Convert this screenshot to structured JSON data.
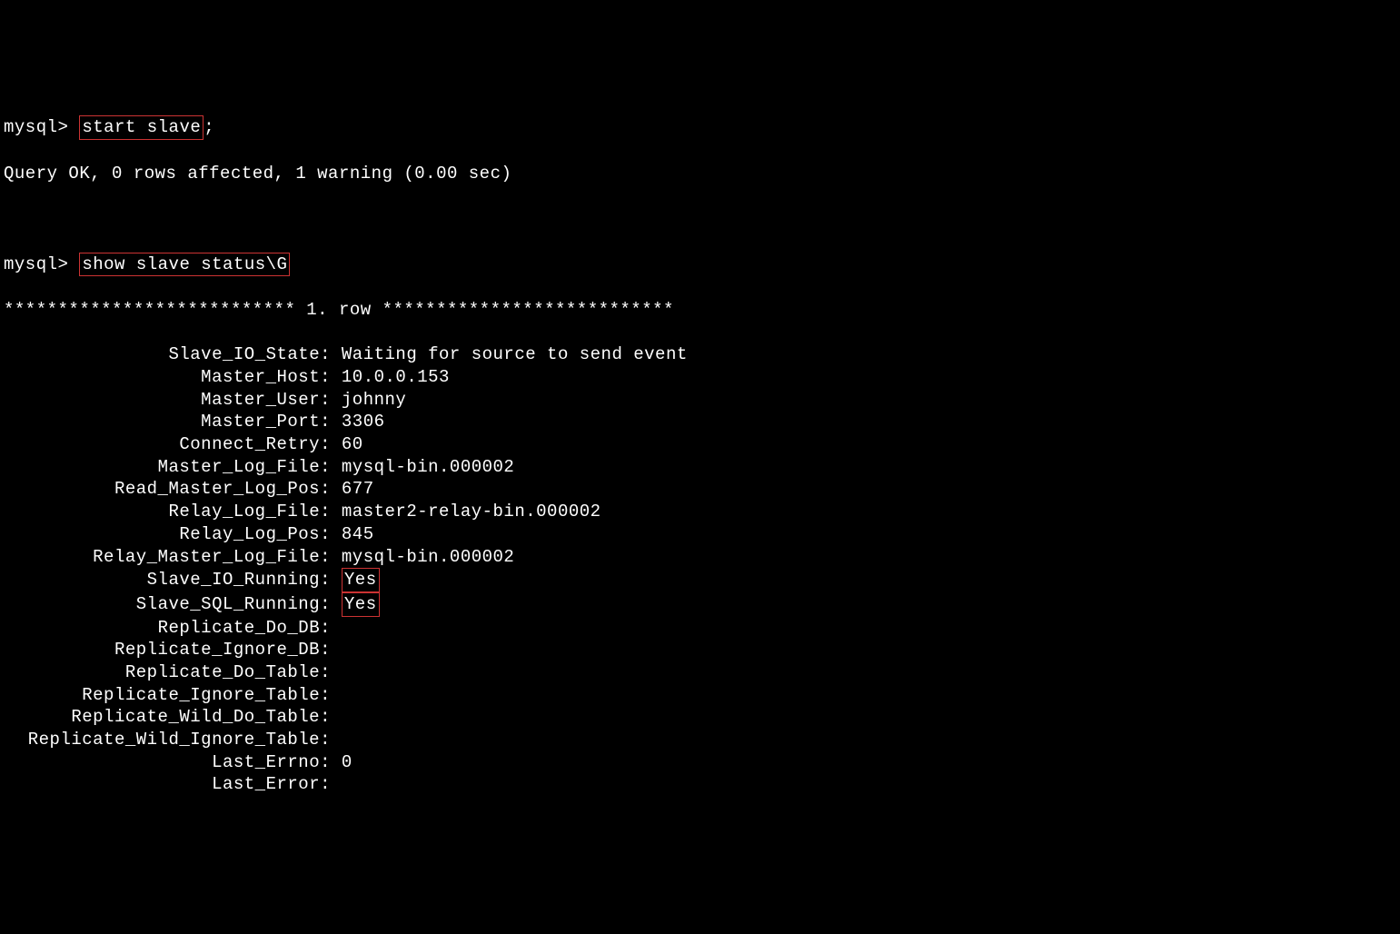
{
  "prompt1": "mysql> ",
  "command1": "start slave",
  "command1_suffix": ";",
  "response1": "Query OK, 0 rows affected, 1 warning (0.00 sec)",
  "prompt2": "mysql> ",
  "command2": "show slave status\\G",
  "row_separator": "*************************** 1. row ***************************",
  "status": {
    "fields": [
      {
        "label": "Slave_IO_State",
        "value": "Waiting for source to send event",
        "highlight": false
      },
      {
        "label": "Master_Host",
        "value": "10.0.0.153",
        "highlight": false
      },
      {
        "label": "Master_User",
        "value": "johnny",
        "highlight": false
      },
      {
        "label": "Master_Port",
        "value": "3306",
        "highlight": false
      },
      {
        "label": "Connect_Retry",
        "value": "60",
        "highlight": false
      },
      {
        "label": "Master_Log_File",
        "value": "mysql-bin.000002",
        "highlight": false
      },
      {
        "label": "Read_Master_Log_Pos",
        "value": "677",
        "highlight": false
      },
      {
        "label": "Relay_Log_File",
        "value": "master2-relay-bin.000002",
        "highlight": false
      },
      {
        "label": "Relay_Log_Pos",
        "value": "845",
        "highlight": false
      },
      {
        "label": "Relay_Master_Log_File",
        "value": "mysql-bin.000002",
        "highlight": false
      },
      {
        "label": "Slave_IO_Running",
        "value": "Yes",
        "highlight": true
      },
      {
        "label": "Slave_SQL_Running",
        "value": "Yes",
        "highlight": true
      },
      {
        "label": "Replicate_Do_DB",
        "value": "",
        "highlight": false
      },
      {
        "label": "Replicate_Ignore_DB",
        "value": "",
        "highlight": false
      },
      {
        "label": "Replicate_Do_Table",
        "value": "",
        "highlight": false
      },
      {
        "label": "Replicate_Ignore_Table",
        "value": "",
        "highlight": false
      },
      {
        "label": "Replicate_Wild_Do_Table",
        "value": "",
        "highlight": false
      },
      {
        "label": "Replicate_Wild_Ignore_Table",
        "value": "",
        "highlight": false
      },
      {
        "label": "Last_Errno",
        "value": "0",
        "highlight": false
      },
      {
        "label": "Last_Error",
        "value": "",
        "highlight": false
      }
    ]
  }
}
